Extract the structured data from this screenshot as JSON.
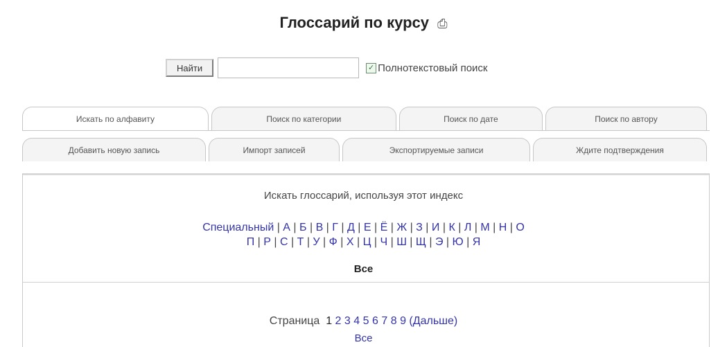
{
  "page": {
    "title": "Глоссарий по курсу",
    "print_icon": "printer-icon"
  },
  "search": {
    "button_label": "Найти",
    "value": "",
    "fulltext_label": "Полнотекстовый поиск",
    "fulltext_checked": true
  },
  "tabs_row1": [
    {
      "label": "Искать по алфавиту",
      "active": true
    },
    {
      "label": "Поиск по категории",
      "active": false
    },
    {
      "label": "Поиск по дате",
      "active": false
    },
    {
      "label": "Поиск по автору",
      "active": false
    }
  ],
  "tabs_row2": [
    {
      "label": "Добавить новую запись"
    },
    {
      "label": "Импорт записей"
    },
    {
      "label": "Экспортируемые записи"
    },
    {
      "label": "Ждите подтверждения"
    }
  ],
  "index": {
    "heading": "Искать глоссарий, используя этот индекс",
    "special_label": "Специальный",
    "letters_line1": [
      "А",
      "Б",
      "В",
      "Г",
      "Д",
      "Е",
      "Ё",
      "Ж",
      "З",
      "И",
      "К",
      "Л",
      "М",
      "Н",
      "О"
    ],
    "letters_line2": [
      "П",
      "Р",
      "С",
      "Т",
      "У",
      "Ф",
      "Х",
      "Ц",
      "Ч",
      "Ш",
      "Щ",
      "Э",
      "Ю",
      "Я"
    ],
    "all_label": "Все"
  },
  "pager": {
    "label": "Страница",
    "current": "1",
    "pages": [
      "2",
      "3",
      "4",
      "5",
      "6",
      "7",
      "8",
      "9"
    ],
    "next_label": "(Дальше)",
    "all_label": "Все"
  }
}
